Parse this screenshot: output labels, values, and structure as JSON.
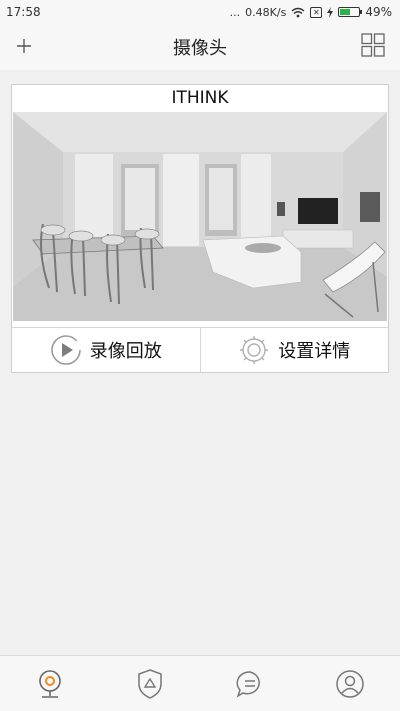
{
  "status": {
    "time": "17:58",
    "signal": "...",
    "speed": "0.48K/s",
    "sim": "✕",
    "battery_level": 0.49,
    "battery_text": "49%"
  },
  "header": {
    "title": "摄像头",
    "add_icon": "plus-icon",
    "layout_icon": "grid-icon"
  },
  "camera": {
    "name": "ITHINK",
    "actions": [
      {
        "label": "录像回放",
        "icon": "play-icon"
      },
      {
        "label": "设置详情",
        "icon": "gear-icon"
      }
    ]
  },
  "nav": {
    "items": [
      {
        "icon": "camera-icon",
        "active": true
      },
      {
        "icon": "shield-icon",
        "active": false
      },
      {
        "icon": "message-icon",
        "active": false
      },
      {
        "icon": "profile-icon",
        "active": false
      }
    ],
    "active_color": "#f08a24"
  }
}
